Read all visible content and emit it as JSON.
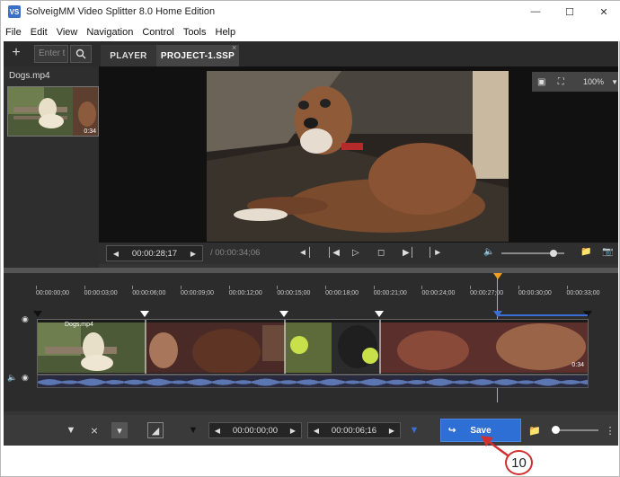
{
  "window": {
    "title": "SolveigMM Video Splitter 8.0 Home Edition",
    "logo": "VS"
  },
  "menu": [
    "File",
    "Edit",
    "View",
    "Navigation",
    "Control",
    "Tools",
    "Help"
  ],
  "toolbar": {
    "search_placeholder": "Enter t"
  },
  "tabs": [
    {
      "label": "PLAYER"
    },
    {
      "label": "PROJECT-1.SSP"
    }
  ],
  "sidebar": {
    "file_name": "Dogs.mp4",
    "duration": "0:34"
  },
  "viewer": {
    "zoom": "100%"
  },
  "controls": {
    "current_time": "00:00:28;17",
    "total_time": "/ 00:00:34;06"
  },
  "timeline": {
    "ticks": [
      "00:00:00;00",
      "00:00:03;00",
      "00:00:06;00",
      "00:00:09;00",
      "00:00:12;00",
      "00:00:15;00",
      "00:00:18;00",
      "00:00:21;00",
      "00:00:24;00",
      "00:00:27;00",
      "00:00:30;00",
      "00:00:33;00"
    ],
    "clip_name": "Dogs.mp4",
    "clip_duration": "0:34"
  },
  "bottom": {
    "start_time": "00:00:00;00",
    "end_time": "00:00:06;16",
    "save_label": "Save"
  },
  "annotation": {
    "number": "10"
  },
  "colors": {
    "accent": "#2e6fd6",
    "playhead": "#f0a020",
    "annotation": "#d03030"
  }
}
